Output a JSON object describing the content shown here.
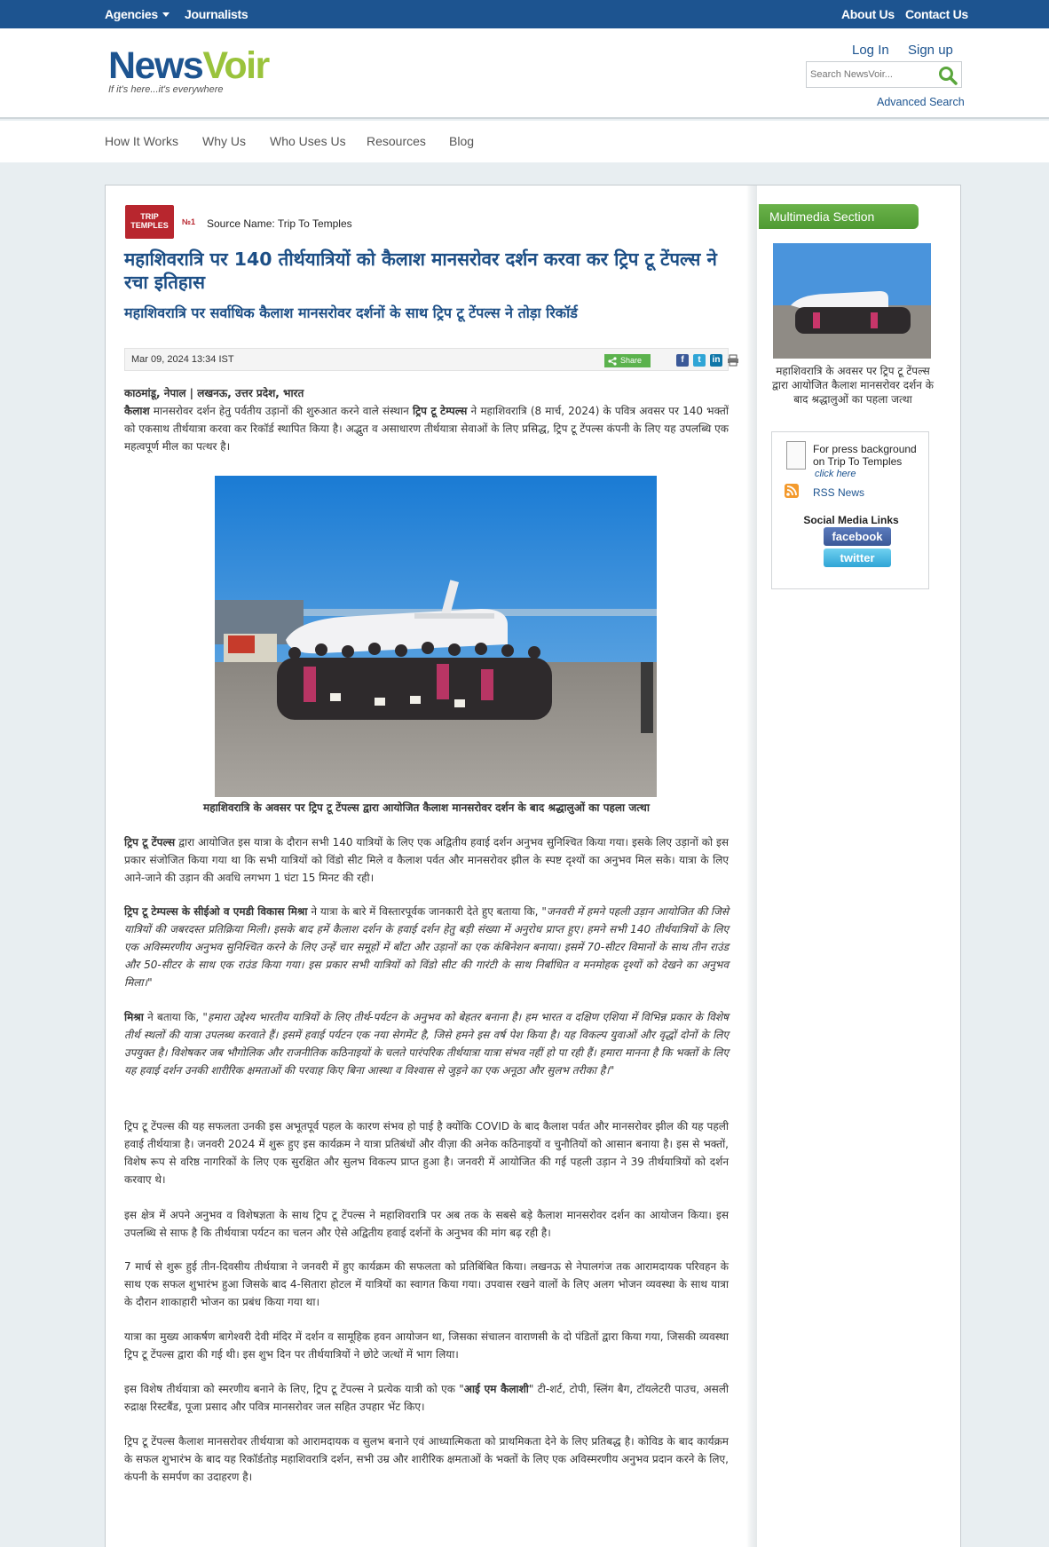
{
  "topbar": {
    "agencies": "Agencies",
    "journalists": "Journalists",
    "about": "About Us",
    "contact": "Contact Us"
  },
  "header": {
    "brand_part1": "News",
    "brand_part2": "Voir",
    "tagline": "If it's here...it's everywhere",
    "login": "Log In",
    "signup": "Sign up",
    "search_placeholder": "Search NewsVoir...",
    "advanced_search": "Advanced Search"
  },
  "nav": {
    "items": [
      "How It Works",
      "Why Us",
      "Who Uses Us",
      "Resources",
      "Blog"
    ]
  },
  "source": {
    "label": "Source Name:",
    "name": "Trip To Temples"
  },
  "article": {
    "title": "महाशिवरात्रि पर 140 तीर्थयात्रियों को कैलाश मानसरोवर दर्शन करवा कर ट्रिप टू टेंपल्स ने रचा इतिहास",
    "subtitle": "महाशिवरात्रि पर सर्वाधिक कैलाश मानसरोवर दर्शनों के साथ ट्रिप टू टेंपल्स ने तोड़ा रिकॉर्ड",
    "date": "Mar 09, 2024 13:34 IST",
    "share_label": "Share",
    "location": "काठमांडू, नेपाल | लखनऊ, उत्तर प्रदेश, भारत",
    "intro_lead": "कैलाश",
    "intro_a": " मानसरोवर दर्शन हेतु पर्वतीय उड़ानों की शुरुआत करने वाले संस्थान ",
    "intro_brand": "ट्रिप टू टेम्पल्स",
    "intro_b": " ने महाशिवरात्रि (8 मार्च, 2024) के पवित्र अवसर पर 140 भक्तों को एकसाथ तीर्थयात्रा करवा कर रिकॉर्ड स्थापित किया है। अद्भुत व असाधारण तीर्थयात्रा सेवाओं के लिए प्रसिद्ध, ट्रिप टू टेंपल्स कंपनी के लिए यह उपलब्धि एक महत्वपूर्ण मील का पत्थर है।",
    "photo_caption": "महाशिवरात्रि के अवसर पर ट्रिप टू टेंपल्स द्वारा आयोजित कैलाश मानसरोवर दर्शन के बाद श्रद्धालुओं का पहला जत्था",
    "p1_lead": "ट्रिप टू टेंपल्स",
    "p1_body": " द्वारा आयोजित इस यात्रा के दौरान सभी 140 यात्रियों के लिए एक अद्वितीय हवाई दर्शन अनुभव सुनिश्चित किया गया। इसके लिए उड़ानों को इस प्रकार संजोजित किया गया था कि सभी यात्रियों को विंडो सीट मिले व कैलाश पर्वत और मानसरोवर झील के स्पष्ट दृश्यों का अनुभव मिल सके। यात्रा के लिए आने-जाने की उड़ान की अवधि लगभग 1 घंटा 15 मिनट की रही।",
    "p2_lead": "ट्रिप टू टेम्पल्स के सीईओ व एमडी विकास मिश्रा",
    "p2_mid": " ने यात्रा के बारे में विस्तारपूर्वक जानकारी देते हुए बताया कि, ",
    "p2_quote": "\"जनवरी में हमने पहली उड़ान आयोजित की जिसे यात्रियों की जबरदस्त प्रतिक्रिया मिली। इसके बाद हमें कैलाश दर्शन के हवाई दर्शन हेतु बड़ी संख्या में अनुरोध प्राप्त हुए। हमने सभी 140 तीर्थयात्रियों के लिए एक अविस्मरणीय अनुभव सुनिश्चित करने के लिए उन्हें चार समूहों में बाँटा और उड़ानों का एक कंबिनेशन बनाया। इसमें 70-सीटर विमानों के साथ तीन राउंड और 50-सीटर के साथ एक राउंड किया गया। इस प्रकार सभी यात्रियों को विंडो सीट की गारंटी के साथ निर्बाधित व मनमोहक दृश्यों को देखने का अनुभव मिला।\"",
    "p3_lead": "मिश्रा",
    "p3_mid": " ने बताया कि, ",
    "p3_quote": "\"हमारा उद्देश्य भारतीय यात्रियों के लिए तीर्थ-पर्यटन के अनुभव को बेहतर बनाना है। हम भारत व दक्षिण एशिया में विभिन्न प्रकार के विशेष तीर्थ स्थलों की यात्रा उपलब्ध करवाते हैं। इसमें हवाई पर्यटन एक नया सेगमेंट है, जिसे हमने इस वर्ष पेश किया है। यह विकल्प युवाओं और वृद्धों दोनों के लिए उपयुक्त है। विशेषकर जब भौगोलिक और राजनीतिक कठिनाइयों के चलते पारंपरिक तीर्थयात्रा यात्रा संभव नहीं हो पा रही हैं। हमारा मानना है कि भक्तों के लिए यह हवाई दर्शन उनकी शारीरिक क्षमताओं की परवाह किए बिना आस्था व विश्वास से जुड़ने का एक अनूठा और सुलभ तरीका है।\"",
    "p4": "ट्रिप टू टेंपल्स की यह सफलता उनकी इस अभूतपूर्व पहल के कारण संभव हो पाई है क्योंकि COVID के बाद कैलाश पर्वत और मानसरोवर झील की यह पहली हवाई तीर्थयात्रा है। जनवरी 2024 में शुरू हुए इस कार्यक्रम ने यात्रा प्रतिबंधों और वीज़ा की अनेक कठिनाइयों व चुनौतियों को आसान बनाया है। इस से भक्तों, विशेष रूप से वरिष्ठ नागरिकों के लिए एक सुरक्षित और सुलभ विकल्प प्राप्त हुआ है। जनवरी में आयोजित की गई पहली उड़ान ने 39 तीर्थयात्रियों को दर्शन करवाए थे।",
    "p5": "इस क्षेत्र में अपने अनुभव व विशेषज्ञता के साथ ट्रिप टू टेंपल्स ने महाशिवरात्रि पर अब तक के सबसे बड़े कैलाश मानसरोवर दर्शन का आयोजन किया। इस उपलब्धि से साफ है कि तीर्थयात्रा पर्यटन का चलन और ऐसे अद्वितीय हवाई दर्शनों के अनुभव की मांग बढ़ रही है।",
    "p6": "7 मार्च से शुरू हुई तीन-दिवसीय तीर्थयात्रा ने जनवरी में हुए कार्यक्रम की सफलता को प्रतिबिंबित किया। लखनऊ से नेपालगंज तक आरामदायक परिवहन के साथ एक सफल शुभारंभ हुआ जिसके बाद 4-सितारा होटल में यात्रियों का स्वागत किया गया। उपवास रखने वालों के लिए अलग भोजन व्यवस्था के साथ यात्रा के दौरान शाकाहारी भोजन का प्रबंध किया गया था।",
    "p7": "यात्रा का मुख्य आकर्षण बागेश्वरी देवी मंदिर में दर्शन व सामूहिक हवन आयोजन था, जिसका संचालन वाराणसी के दो पंडितों द्वारा किया गया, जिसकी व्यवस्था ट्रिप टू टेंपल्स द्वारा की गई थी। इस शुभ दिन पर तीर्थयात्रियों ने छोटे जत्थों में भाग लिया।",
    "p8_a": "इस विशेष तीर्थयात्रा को स्मरणीय बनाने के लिए, ट्रिप टू टेंपल्स ने प्रत्येक यात्री को एक \"",
    "p8_bold": "आई एम कैलाशी",
    "p8_b": "\" टी-शर्ट, टोपी, स्लिंग बैग, टॉयलेटरी पाउच, असली रुद्राक्ष रिस्टबैंड, पूजा प्रसाद और पवित्र मानसरोवर जल सहित उपहार भेंट किए।",
    "p9": "ट्रिप टू टेंपल्स कैलाश मानसरोवर तीर्थयात्रा को आरामदायक व सुलभ बनाने एवं आध्यात्मिकता को प्राथमिकता देने के लिए प्रतिबद्ध है। कोविड के बाद कार्यक्रम के सफल शुभारंभ के बाद यह रिकॉर्डतोड़ महाशिवरात्रि दर्शन, सभी उम्र और शारीरिक क्षमताओं के भक्तों के लिए एक अविस्मरणीय अनुभव प्रदान करने के लिए, कंपनी के समर्पण का उदाहरण है।"
  },
  "sidebar": {
    "multimedia_title": "Multimedia Section",
    "multimedia_caption": "महाशिवरात्रि के अवसर पर ट्रिप टू टेंपल्स द्वारा आयोजित कैलाश मानसरोवर दर्शन के बाद श्रद्धालुओं का पहला जत्था",
    "press_line1": "For press background",
    "press_line2": "on Trip To Temples",
    "click_here": "click here",
    "rss": "RSS News",
    "social_title": "Social Media Links",
    "facebook": "facebook",
    "twitter": "twitter"
  },
  "colors": {
    "brand_blue": "#1d5490",
    "brand_green": "#9ac33c",
    "headline_blue": "#1d4f86",
    "multimedia_green": "#5aa63c"
  }
}
